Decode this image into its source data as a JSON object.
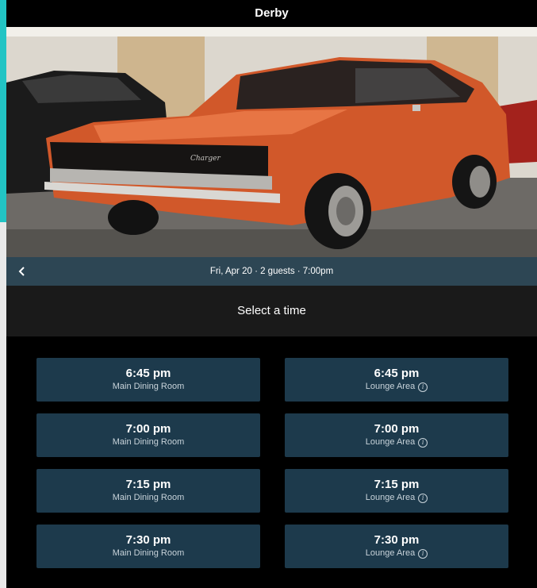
{
  "restaurant": {
    "name": "Derby"
  },
  "hero": {
    "image": "orange-muscle-car-photo"
  },
  "reservation": {
    "summary": "Fri, Apr 20  ·  2 guests  ·  7:00pm",
    "back_icon": "chevron-left-icon"
  },
  "section": {
    "title": "Select a time"
  },
  "slots": [
    {
      "time": "6:45 pm",
      "area": "Main Dining Room",
      "info": false
    },
    {
      "time": "6:45 pm",
      "area": "Lounge Area",
      "info": true
    },
    {
      "time": "7:00 pm",
      "area": "Main Dining Room",
      "info": false
    },
    {
      "time": "7:00 pm",
      "area": "Lounge Area",
      "info": true
    },
    {
      "time": "7:15 pm",
      "area": "Main Dining Room",
      "info": false
    },
    {
      "time": "7:15 pm",
      "area": "Lounge Area",
      "info": true
    },
    {
      "time": "7:30 pm",
      "area": "Main Dining Room",
      "info": false
    },
    {
      "time": "7:30 pm",
      "area": "Lounge Area",
      "info": true
    }
  ],
  "colors": {
    "accent": "#22c4c4",
    "slot_bg": "#1d3a4c",
    "info_bar": "#2d4654",
    "select_bar": "#1a1a1a"
  }
}
